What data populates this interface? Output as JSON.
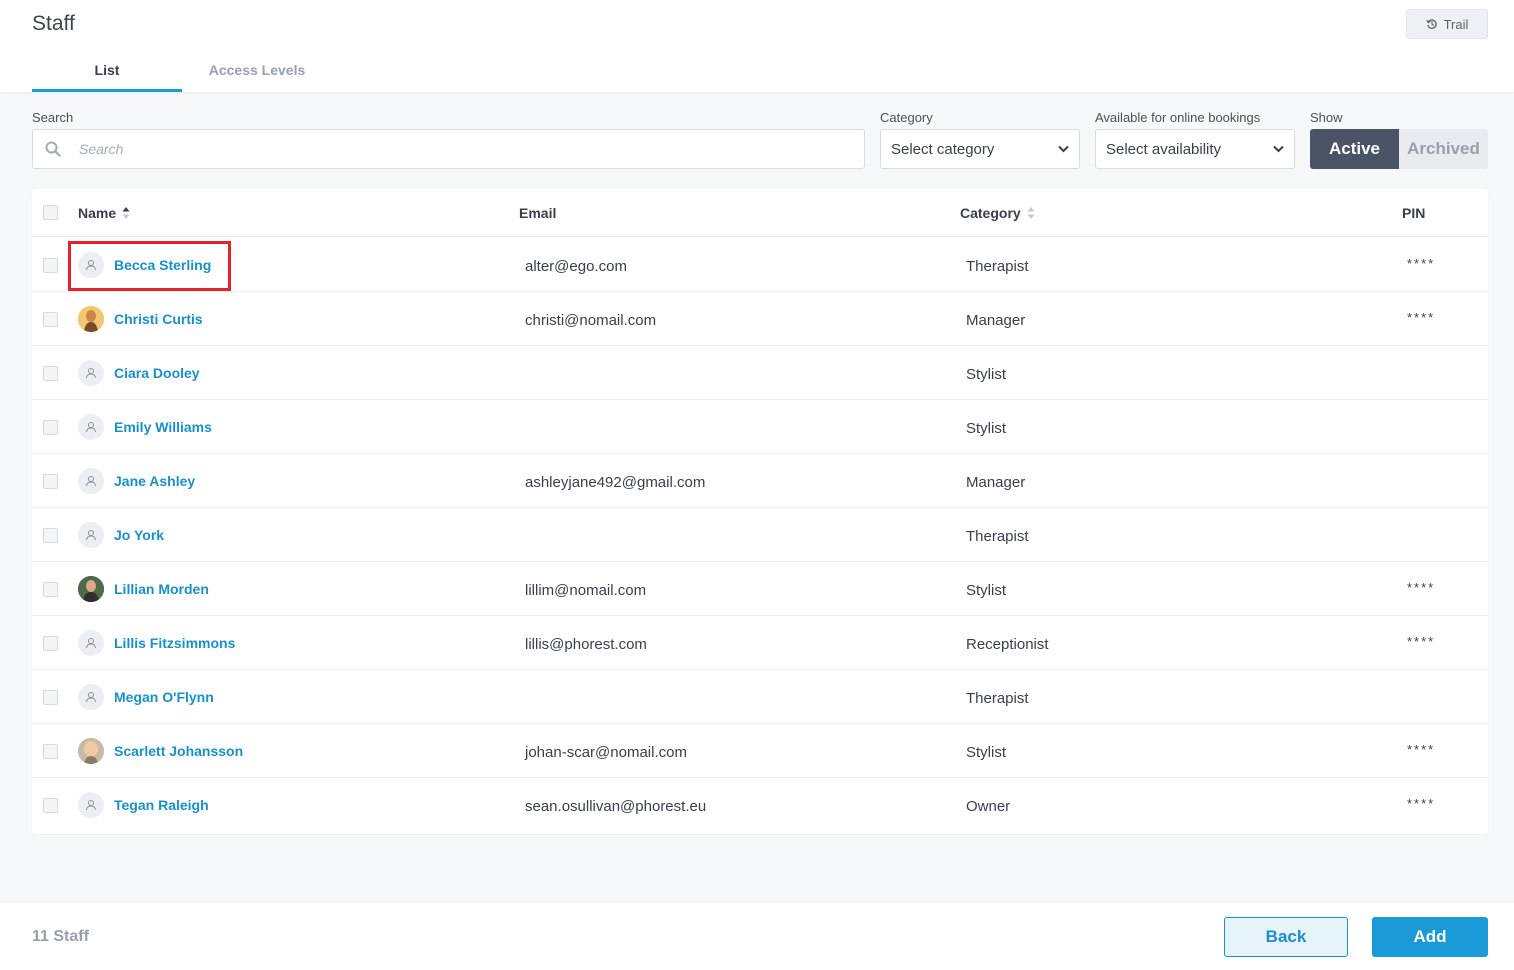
{
  "header": {
    "title": "Staff",
    "trail_label": "Trail",
    "tabs": [
      {
        "label": "List",
        "active": true
      },
      {
        "label": "Access Levels",
        "active": false
      }
    ]
  },
  "filters": {
    "search_label": "Search",
    "search_placeholder": "Search",
    "search_value": "",
    "category_label": "Category",
    "category_value": "Select category",
    "availability_label": "Available for online bookings",
    "availability_value": "Select availability",
    "show_label": "Show",
    "show_options": [
      "Active",
      "Archived"
    ],
    "show_selected": "Active"
  },
  "table": {
    "columns": [
      "Name",
      "Email",
      "Category",
      "PIN"
    ],
    "rows": [
      {
        "name": "Becca Sterling",
        "email": "alter@ego.com",
        "category": "Therapist",
        "pin": "****",
        "avatar": "user-icon"
      },
      {
        "name": "Christi Curtis",
        "email": "christi@nomail.com",
        "category": "Manager",
        "pin": "****",
        "avatar": "photo"
      },
      {
        "name": "Ciara Dooley",
        "email": "",
        "category": "Stylist",
        "pin": "",
        "avatar": "user-icon"
      },
      {
        "name": "Emily Williams",
        "email": "",
        "category": "Stylist",
        "pin": "",
        "avatar": "user-icon"
      },
      {
        "name": "Jane Ashley",
        "email": "ashleyjane492@gmail.com",
        "category": "Manager",
        "pin": "",
        "avatar": "user-icon"
      },
      {
        "name": "Jo York",
        "email": "",
        "category": "Therapist",
        "pin": "",
        "avatar": "user-icon"
      },
      {
        "name": "Lillian Morden",
        "email": "lillim@nomail.com",
        "category": "Stylist",
        "pin": "****",
        "avatar": "photo"
      },
      {
        "name": "Lillis Fitzsimmons",
        "email": "lillis@phorest.com",
        "category": "Receptionist",
        "pin": "****",
        "avatar": "user-icon"
      },
      {
        "name": "Megan O'Flynn",
        "email": "",
        "category": "Therapist",
        "pin": "",
        "avatar": "user-icon"
      },
      {
        "name": "Scarlett Johansson",
        "email": "johan-scar@nomail.com",
        "category": "Stylist",
        "pin": "****",
        "avatar": "photo"
      },
      {
        "name": "Tegan Raleigh",
        "email": "sean.osullivan@phorest.eu",
        "category": "Owner",
        "pin": "****",
        "avatar": "user-icon"
      }
    ]
  },
  "footer": {
    "count_label": "11 Staff",
    "back_label": "Back",
    "add_label": "Add"
  },
  "colors": {
    "accent": "#1a9ad6",
    "link": "#1a8fc9",
    "toggle_active": "#4a5466",
    "highlight": "#e3222b"
  }
}
